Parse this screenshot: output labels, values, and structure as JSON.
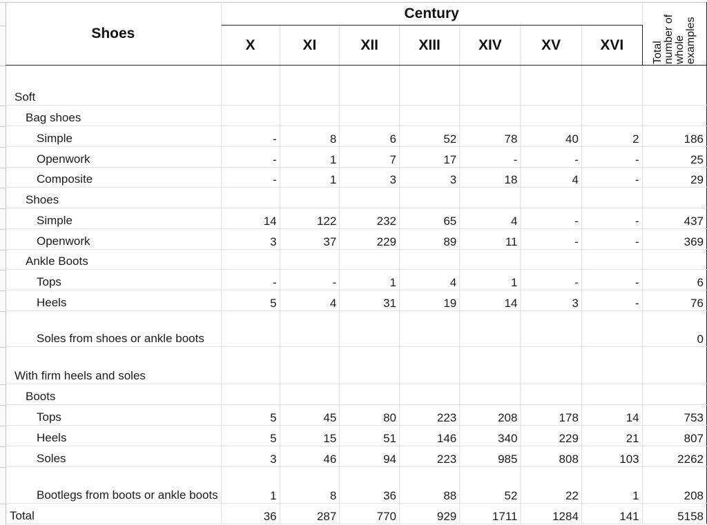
{
  "table": {
    "corner_header": "Shoes",
    "group_header": "Century",
    "century_columns": [
      "X",
      "XI",
      "XII",
      "XIII",
      "XIV",
      "XV",
      "XVI"
    ],
    "total_header": "Total number of whole examples",
    "rows": [
      {
        "label": "Soft",
        "level": 0,
        "cells": [
          "",
          "",
          "",
          "",
          "",
          "",
          "",
          ""
        ]
      },
      {
        "label": "Bag shoes",
        "level": 1,
        "cells": [
          "",
          "",
          "",
          "",
          "",
          "",
          "",
          ""
        ]
      },
      {
        "label": "Simple",
        "level": 2,
        "cells": [
          "-",
          "8",
          "6",
          "52",
          "78",
          "40",
          "2",
          "186"
        ]
      },
      {
        "label": "Openwork",
        "level": 2,
        "cells": [
          "-",
          "1",
          "7",
          "17",
          "-",
          "-",
          "-",
          "25"
        ]
      },
      {
        "label": "Composite",
        "level": 2,
        "cells": [
          "-",
          "1",
          "3",
          "3",
          "18",
          "4",
          "-",
          "29"
        ]
      },
      {
        "label": "Shoes",
        "level": 1,
        "cells": [
          "",
          "",
          "",
          "",
          "",
          "",
          "",
          ""
        ]
      },
      {
        "label": "Simple",
        "level": 2,
        "cells": [
          "14",
          "122",
          "232",
          "65",
          "4",
          "-",
          "-",
          "437"
        ]
      },
      {
        "label": "Openwork",
        "level": 2,
        "cells": [
          "3",
          "37",
          "229",
          "89",
          "11",
          "-",
          "-",
          "369"
        ]
      },
      {
        "label": "Ankle Boots",
        "level": 1,
        "cells": [
          "",
          "",
          "",
          "",
          "",
          "",
          "",
          ""
        ]
      },
      {
        "label": "Tops",
        "level": 2,
        "cells": [
          "-",
          "-",
          "1",
          "4",
          "1",
          "-",
          "-",
          "6"
        ]
      },
      {
        "label": "Heels",
        "level": 2,
        "cells": [
          "5",
          "4",
          "31",
          "19",
          "14",
          "3",
          "-",
          "76"
        ]
      },
      {
        "label": "Soles from shoes or ankle boots",
        "level": 2,
        "cells": [
          "",
          "",
          "",
          "",
          "",
          "",
          "",
          "0"
        ]
      },
      {
        "label": "With firm heels and soles",
        "level": 0,
        "cells": [
          "",
          "",
          "",
          "",
          "",
          "",
          "",
          ""
        ]
      },
      {
        "label": "Boots",
        "level": 1,
        "cells": [
          "",
          "",
          "",
          "",
          "",
          "",
          "",
          ""
        ]
      },
      {
        "label": "Tops",
        "level": 2,
        "cells": [
          "5",
          "45",
          "80",
          "223",
          "208",
          "178",
          "14",
          "753"
        ]
      },
      {
        "label": "Heels",
        "level": 2,
        "cells": [
          "5",
          "15",
          "51",
          "146",
          "340",
          "229",
          "21",
          "807"
        ]
      },
      {
        "label": "Soles",
        "level": 2,
        "cells": [
          "3",
          "46",
          "94",
          "223",
          "985",
          "808",
          "103",
          "2262"
        ]
      },
      {
        "label": "Bootlegs from boots or ankle boots",
        "level": 2,
        "cells": [
          "1",
          "8",
          "36",
          "88",
          "52",
          "22",
          "1",
          "208"
        ]
      }
    ],
    "total_row": {
      "label": "Total",
      "cells": [
        "36",
        "287",
        "770",
        "929",
        "1711",
        "1284",
        "141",
        "5158"
      ]
    }
  }
}
